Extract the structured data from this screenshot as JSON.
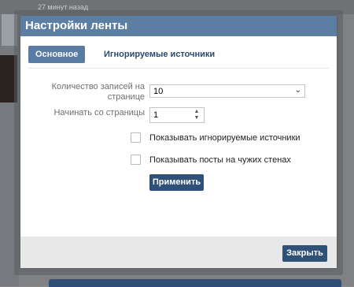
{
  "background": {
    "time_ago": "27 минут назад"
  },
  "dialog": {
    "title": "Настройки ленты",
    "tabs": [
      {
        "label": "Основное",
        "active": true
      },
      {
        "label": "Игнорируемые источники",
        "active": false
      }
    ],
    "posts_per_page": {
      "label": "Количество записей на странице",
      "value": "10"
    },
    "start_page": {
      "label": "Начинать со страницы",
      "value": "1"
    },
    "checkboxes": [
      {
        "label": "Показывать игнорируемые источники",
        "checked": false
      },
      {
        "label": "Показывать посты на чужих стенах",
        "checked": false
      }
    ],
    "apply_label": "Применить",
    "close_label": "Закрыть"
  },
  "colors": {
    "header": "#5c7ea3",
    "button": "#2f5178",
    "tab_inactive_text": "#2b4a6e"
  },
  "icons": {
    "select_arrow": "chevron-down-icon",
    "stepper_up": "chevron-up-icon",
    "stepper_down": "chevron-down-icon"
  }
}
